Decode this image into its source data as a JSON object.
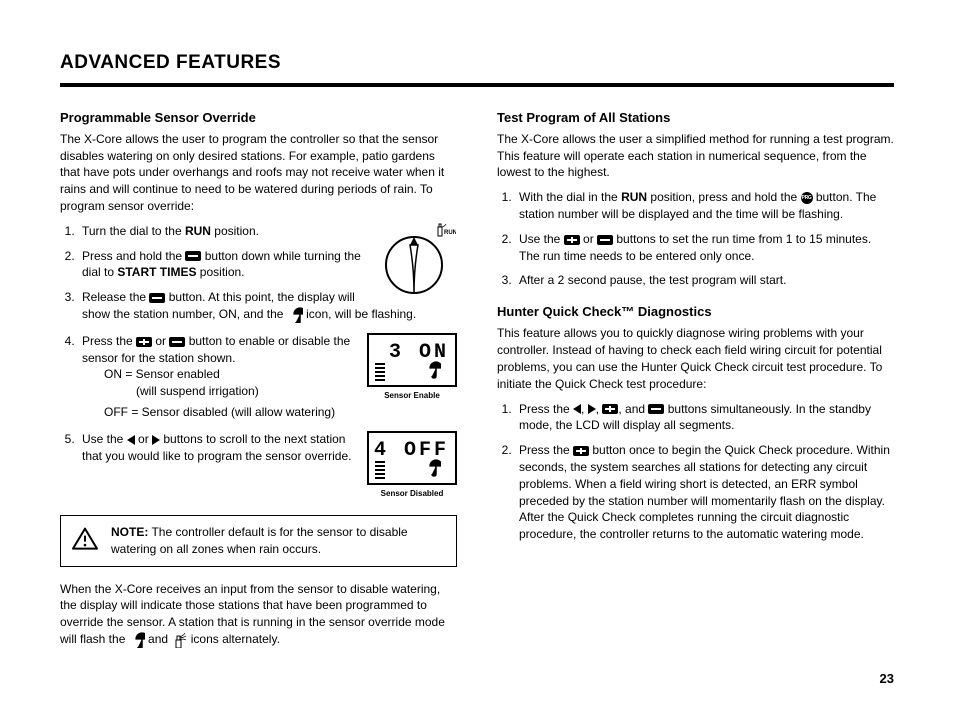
{
  "page_title": "ADVANCED FEATURES",
  "page_number": "23",
  "left": {
    "heading": "Programmable Sensor Override",
    "intro": "The X-Core allows the user to program the controller so that the sensor disables watering on only desired stations. For example, patio gardens that have pots under overhangs and roofs may not receive water when it rains and will continue to need to be watered during periods of rain. To program sensor override:",
    "step1_a": "Turn the dial to the ",
    "step1_run": "RUN",
    "step1_b": " position.",
    "step2_a": "Press and hold the ",
    "step2_b": " button down while turning the dial to ",
    "step2_start": "START TIMES",
    "step2_c": " position.",
    "step3_a": "Release the ",
    "step3_b": " button. At this point, the display will show the station number, ON, and the ",
    "step3_c": " icon, will be flashing.",
    "step4_a": "Press the ",
    "step4_b": " or ",
    "step4_c": " button to enable or disable the sensor for the station shown.",
    "on_label": "ON = Sensor enabled",
    "on_sub": "(will suspend irrigation)",
    "off_label": "OFF = Sensor disabled (will allow watering)",
    "step5_a": "Use the ",
    "step5_b": " or ",
    "step5_c": " buttons to scroll to the next station that you would like to program the sensor override.",
    "note_prefix": "NOTE:",
    "note_body": " The controller default is for the sensor to disable watering on all zones when rain occurs.",
    "closing_a": "When the X-Core receives an input from the sensor to disable watering, the display will indicate those stations that have been programmed to override the sensor. A station that is running in the sensor override mode will flash the ",
    "closing_b": " and ",
    "closing_c": " icons alternately.",
    "dial_run": "RUN",
    "lcd1_text": "3 ON",
    "lcd1_caption": "Sensor Enable",
    "lcd2_text": "4 OFF",
    "lcd2_caption": "Sensor Disabled"
  },
  "right": {
    "heading1": "Test Program of All Stations",
    "intro1": "The X-Core allows the user a simplified method for running a test program. This feature will operate each station in numerical sequence, from the lowest to the highest.",
    "r_step1_a": "With the dial in the ",
    "r_step1_run": "RUN",
    "r_step1_b": " position, press and hold the ",
    "r_step1_c": " button. The station number will be displayed and the time will be flashing.",
    "r_step2_a": "Use the ",
    "r_step2_b": " or ",
    "r_step2_c": " buttons to set the run time from 1 to 15 minutes. The run time needs to be entered only once.",
    "r_step3": "After a 2 second pause, the test program will start.",
    "heading2": "Hunter Quick Check™ Diagnostics",
    "intro2": "This feature allows you to quickly diagnose wiring problems with your controller. Instead of having to check each field wiring circuit for potential problems, you can use the Hunter Quick Check circuit test procedure. To initiate the Quick Check test procedure:",
    "q_step1_a": "Press the ",
    "q_step1_b": ", ",
    "q_step1_c": ", ",
    "q_step1_d": ", and ",
    "q_step1_e": " buttons simultaneously. In the standby mode, the LCD will display all segments.",
    "q_step2_a": "Press the ",
    "q_step2_b": " button once to begin the Quick Check procedure. Within seconds, the system searches all stations for detecting any circuit problems. When a field wiring short is detected, an ERR symbol preceded by the station number will momentarily flash on the display. After the Quick Check completes running the circuit diagnostic procedure, the controller returns to the automatic watering mode."
  }
}
